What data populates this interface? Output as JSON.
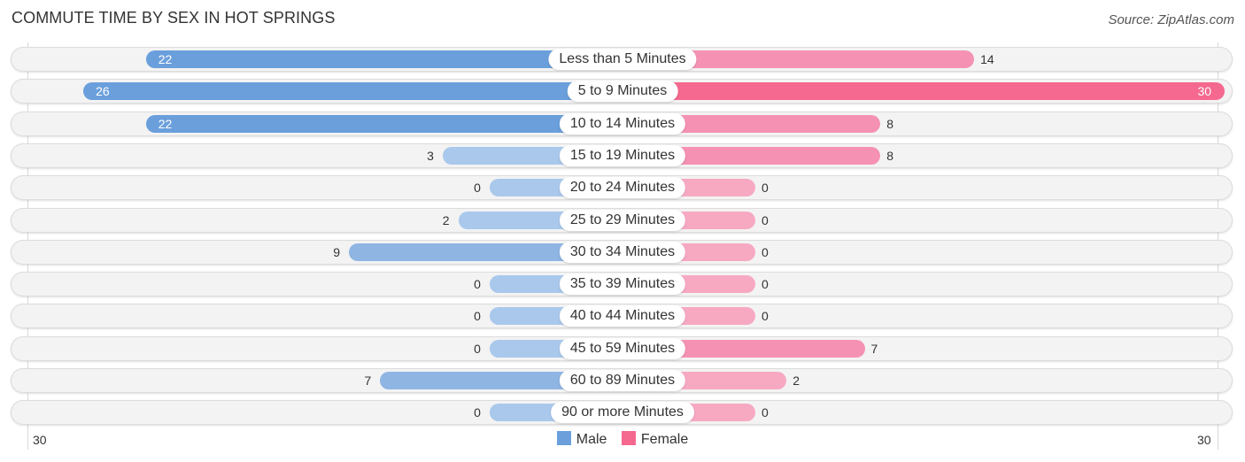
{
  "header": {
    "title": "COMMUTE TIME BY SEX IN HOT SPRINGS",
    "source": "Source: ZipAtlas.com"
  },
  "chart_data": {
    "type": "bar",
    "orientation": "horizontal-diverging",
    "title": "COMMUTE TIME BY SEX IN HOT SPRINGS",
    "categories": [
      "Less than 5 Minutes",
      "5 to 9 Minutes",
      "10 to 14 Minutes",
      "15 to 19 Minutes",
      "20 to 24 Minutes",
      "25 to 29 Minutes",
      "30 to 34 Minutes",
      "35 to 39 Minutes",
      "40 to 44 Minutes",
      "45 to 59 Minutes",
      "60 to 89 Minutes",
      "90 or more Minutes"
    ],
    "series": [
      {
        "name": "Male",
        "color": "#6a9fdc",
        "values": [
          22,
          26,
          22,
          3,
          0,
          2,
          9,
          0,
          0,
          0,
          7,
          0
        ]
      },
      {
        "name": "Female",
        "color": "#f5688f",
        "values": [
          14,
          30,
          8,
          8,
          0,
          0,
          0,
          0,
          0,
          7,
          2,
          0
        ]
      }
    ],
    "axis": {
      "left_tick": "30",
      "right_tick": "30",
      "max": 30
    },
    "legend": {
      "position": "bottom-center",
      "items": [
        "Male",
        "Female"
      ]
    },
    "xlabel": "",
    "ylabel": ""
  }
}
